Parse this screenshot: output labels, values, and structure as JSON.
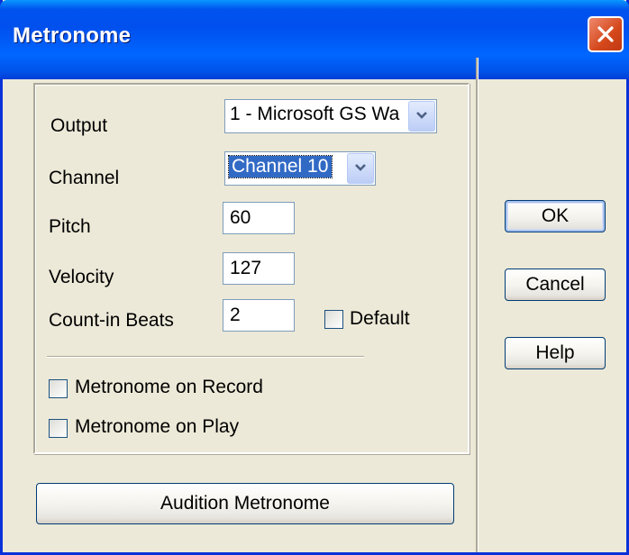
{
  "window": {
    "title": "Metronome"
  },
  "form": {
    "output": {
      "label": "Output",
      "value": "1 - Microsoft GS Wa"
    },
    "channel": {
      "label": "Channel",
      "value": "Channel 10"
    },
    "pitch": {
      "label": "Pitch",
      "value": "60"
    },
    "velocity": {
      "label": "Velocity",
      "value": "127"
    },
    "count_in": {
      "label": "Count-in Beats",
      "value": "2"
    },
    "default_checkbox": {
      "label": "Default",
      "checked": false
    },
    "metronome_on_record": {
      "label": "Metronome on Record",
      "checked": false
    },
    "metronome_on_play": {
      "label": "Metronome on Play",
      "checked": false
    }
  },
  "buttons": {
    "ok": "OK",
    "cancel": "Cancel",
    "help": "Help",
    "audition": "Audition Metronome"
  },
  "colors": {
    "titlebar": "#0053ee",
    "dialog_bg": "#ece9d8",
    "selection": "#316ac5",
    "close_button": "#d4471b"
  }
}
